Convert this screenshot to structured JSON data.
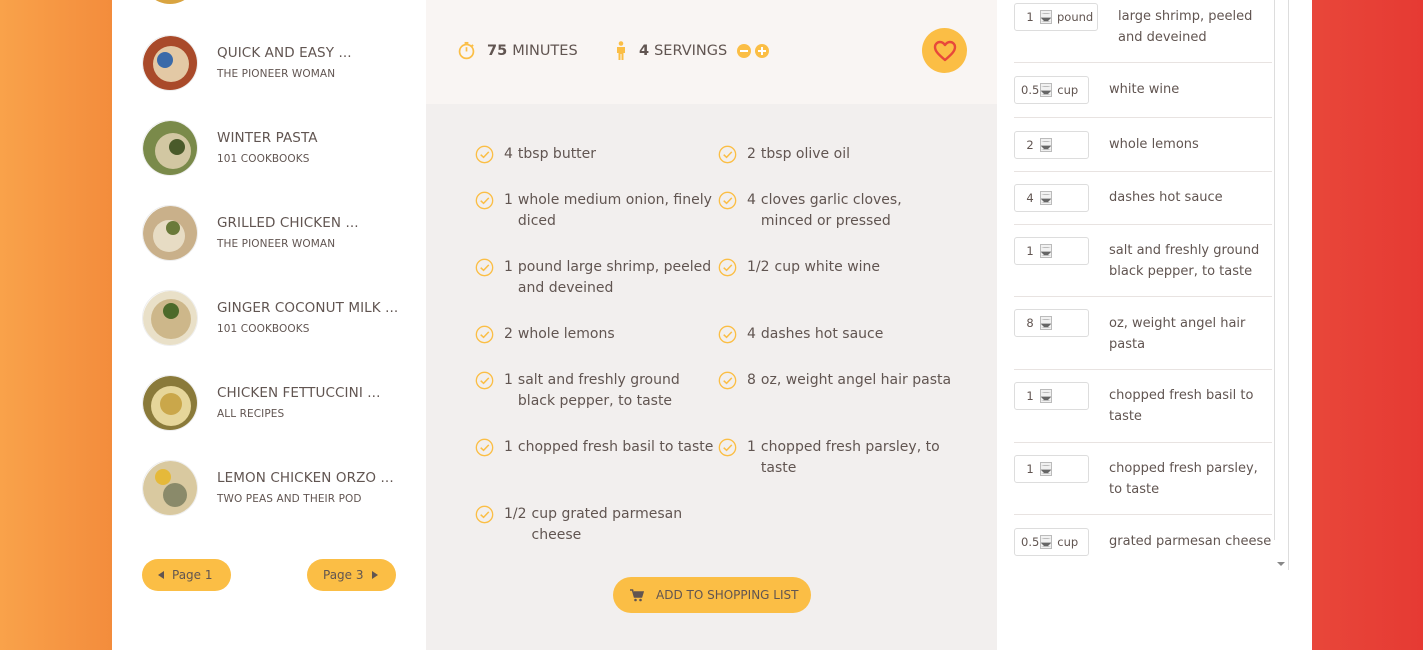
{
  "colors": {
    "accent": "#fbbe45",
    "text": "#615551",
    "heart": "#e8483a",
    "recipe_bg": "#f2efee",
    "details_bg": "#f9f5f3"
  },
  "results": [
    {
      "title": "QUICK AND EASY ...",
      "publisher": "THE PIONEER WOMAN",
      "thumb_colors": [
        "#a94a2a",
        "#e3c9a5",
        "#3a6aa9"
      ]
    },
    {
      "title": "WINTER PASTA",
      "publisher": "101 COOKBOOKS",
      "thumb_colors": [
        "#7a8a4a",
        "#d2c7a2",
        "#4a5a2a"
      ]
    },
    {
      "title": "GRILLED CHICKEN ...",
      "publisher": "THE PIONEER WOMAN",
      "thumb_colors": [
        "#c9b08a",
        "#6a7a3a",
        "#e7dcc4"
      ]
    },
    {
      "title": "GINGER COCONUT MILK ...",
      "publisher": "101 COOKBOOKS",
      "thumb_colors": [
        "#cdb78a",
        "#4d6a2a",
        "#e9e0c8"
      ]
    },
    {
      "title": "CHICKEN FETTUCCINI ...",
      "publisher": "ALL RECIPES",
      "thumb_colors": [
        "#caa74a",
        "#8a7a3a",
        "#e6d69a"
      ]
    },
    {
      "title": "LEMON CHICKEN ORZO ...",
      "publisher": "TWO PEAS AND THEIR POD",
      "thumb_colors": [
        "#d9c9a0",
        "#e5b93a",
        "#8a8a6a"
      ]
    }
  ],
  "pagination": {
    "prev_label": "Page 1",
    "next_label": "Page 3"
  },
  "recipe": {
    "time_value": "75",
    "time_unit": "minutes",
    "servings_value": "4",
    "servings_unit": "servings",
    "ingredients": [
      {
        "qty": "4",
        "text": "tbsp butter"
      },
      {
        "qty": "2",
        "text": "tbsp olive oil"
      },
      {
        "qty": "1",
        "text": "whole medium onion, finely diced"
      },
      {
        "qty": "4",
        "text": "cloves garlic cloves, minced or pressed"
      },
      {
        "qty": "1",
        "text": "pound large shrimp, peeled and deveined"
      },
      {
        "qty": "1/2",
        "text": "cup white wine"
      },
      {
        "qty": "2",
        "text": "whole lemons"
      },
      {
        "qty": "4",
        "text": "dashes hot sauce"
      },
      {
        "qty": "1",
        "text": "salt and freshly ground black pepper, to taste"
      },
      {
        "qty": "8",
        "text": "oz, weight angel hair pasta"
      },
      {
        "qty": "1",
        "text": "chopped fresh basil to taste"
      },
      {
        "qty": "1",
        "text": "chopped fresh parsley, to taste"
      },
      {
        "qty": "1/2",
        "text": "cup grated parmesan cheese"
      }
    ],
    "add_to_list_label": "Add to shopping list"
  },
  "shopping": [
    {
      "qty": "1",
      "unit": "pound",
      "desc": "large shrimp, peeled and deveined"
    },
    {
      "qty": "0.5",
      "unit": "cup",
      "desc": "white wine"
    },
    {
      "qty": "2",
      "unit": "",
      "desc": "whole lemons"
    },
    {
      "qty": "4",
      "unit": "",
      "desc": "dashes hot sauce"
    },
    {
      "qty": "1",
      "unit": "",
      "desc": "salt and freshly ground black pepper, to taste"
    },
    {
      "qty": "8",
      "unit": "",
      "desc": "oz, weight angel hair pasta"
    },
    {
      "qty": "1",
      "unit": "",
      "desc": "chopped fresh basil to taste"
    },
    {
      "qty": "1",
      "unit": "",
      "desc": "chopped fresh parsley, to taste"
    },
    {
      "qty": "0.5",
      "unit": "cup",
      "desc": "grated parmesan cheese"
    }
  ]
}
